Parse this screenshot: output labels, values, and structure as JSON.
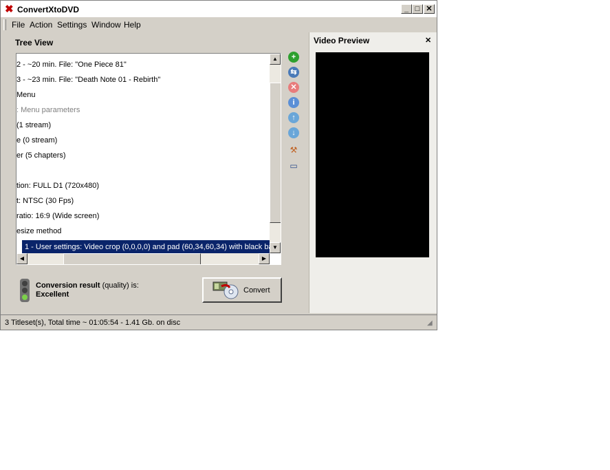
{
  "window": {
    "title": "ConvertXtoDVD",
    "min_label": "_",
    "max_label": "□",
    "close_label": "✕"
  },
  "menu": [
    "File",
    "Action",
    "Settings",
    "Window",
    "Help"
  ],
  "tree": {
    "title": "Tree View",
    "rows": [
      {
        "text": "2 - ~20 min. File: \"One Piece 81\"",
        "dim": false
      },
      {
        "text": "3 - ~23 min. File: \"Death Note 01 - Rebirth\"",
        "dim": false
      },
      {
        "text": "  Menu",
        "dim": false
      },
      {
        "text": ": Menu parameters",
        "dim": true
      },
      {
        "text": "(1 stream)",
        "dim": false
      },
      {
        "text": "e (0 stream)",
        "dim": false
      },
      {
        "text": "er (5 chapters)",
        "dim": false
      },
      {
        "text": "",
        "dim": false
      },
      {
        "text": "tion: FULL D1 (720x480)",
        "dim": false
      },
      {
        "text": "t: NTSC (30 Fps)",
        "dim": false
      },
      {
        "text": "ratio: 16:9 (Wide screen)",
        "dim": false
      },
      {
        "text": "esize method",
        "dim": false
      }
    ],
    "selected_row": "1 - User settings: Video crop (0,0,0,0) and pad (60,34,60,34) with black ba"
  },
  "side_tools": [
    {
      "icon": "add-icon",
      "glyph": "+",
      "color": "#2ea02e"
    },
    {
      "icon": "merge-icon",
      "glyph": "⇆",
      "color": "#4a7ab8"
    },
    {
      "icon": "remove-icon",
      "glyph": "✕",
      "color": "#e87c7c"
    },
    {
      "icon": "info-icon",
      "glyph": "i",
      "color": "#5b8fd6"
    },
    {
      "icon": "move-up-icon",
      "glyph": "↑",
      "color": "#6aa6d8"
    },
    {
      "icon": "move-down-icon",
      "glyph": "↓",
      "color": "#6aa6d8"
    },
    {
      "icon": "tools-icon",
      "glyph": "⚒",
      "color": "#c06020"
    },
    {
      "icon": "screen-icon",
      "glyph": "▭",
      "color": "#2a4a8a"
    }
  ],
  "result": {
    "prefix": "Conversion result",
    "suffix": " (quality) is:",
    "value": "Excellent",
    "light_active": "green"
  },
  "convert_button": {
    "label": "Convert"
  },
  "preview": {
    "title": "Video Preview",
    "close_label": "✕"
  },
  "status": {
    "text": "3 Titleset(s), Total time ~ 01:05:54 - 1.41 Gb. on disc"
  }
}
